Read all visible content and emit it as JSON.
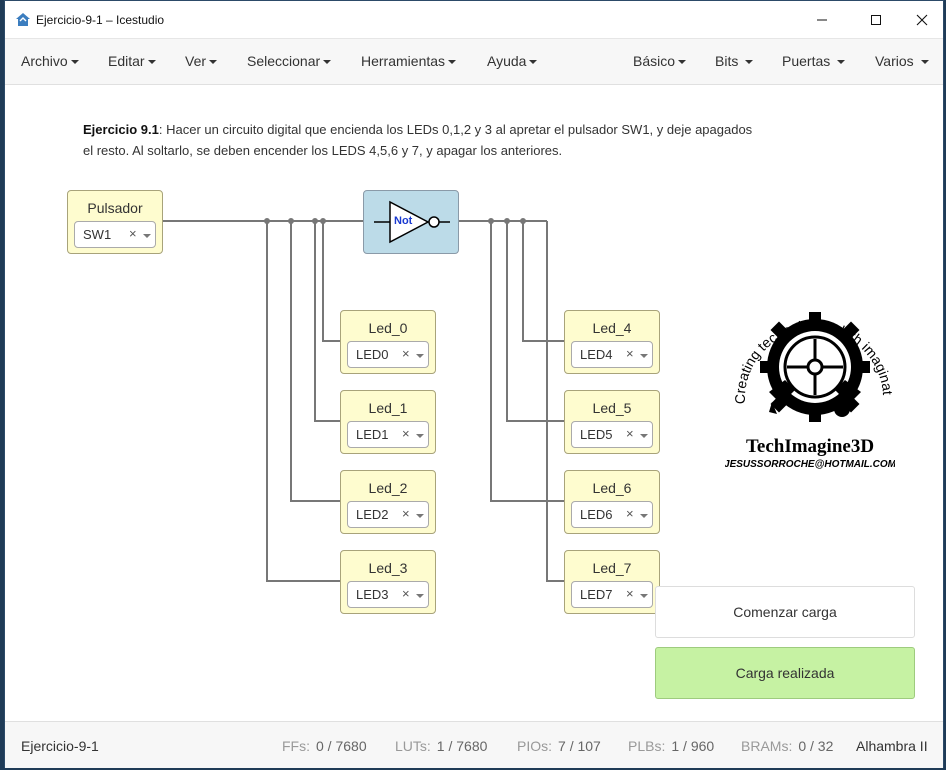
{
  "window": {
    "title": "Ejercicio-9-1 – Icestudio"
  },
  "menu": {
    "left": [
      "Archivo",
      "Editar",
      "Ver",
      "Seleccionar",
      "Herramientas",
      "Ayuda"
    ],
    "right": [
      "Básico",
      "Bits",
      "Puertas",
      "Varios"
    ]
  },
  "description": {
    "title": "Ejercicio 9.1",
    "text": ": Hacer un circuito digital que encienda los LEDs 0,1,2 y 3 al apretar el pulsador SW1, y deje apagados el resto. Al soltarlo, se deben encender los LEDS 4,5,6 y 7, y apagar los anteriores."
  },
  "input_block": {
    "label": "Pulsador",
    "value": "SW1"
  },
  "not_gate": {
    "label": "Not"
  },
  "leds_left": [
    {
      "label": "Led_0",
      "value": "LED0"
    },
    {
      "label": "Led_1",
      "value": "LED1"
    },
    {
      "label": "Led_2",
      "value": "LED2"
    },
    {
      "label": "Led_3",
      "value": "LED3"
    }
  ],
  "leds_right": [
    {
      "label": "Led_4",
      "value": "LED4"
    },
    {
      "label": "Led_5",
      "value": "LED5"
    },
    {
      "label": "Led_6",
      "value": "LED6"
    },
    {
      "label": "Led_7",
      "value": "LED7"
    }
  ],
  "select_clear": "×",
  "logo": {
    "arc_text": "Creating technology whith imagination",
    "brand": "TechImagine3D",
    "email": "JESUSSORROCHE@HOTMAIL.COM"
  },
  "buttons": {
    "start_upload": "Comenzar carga",
    "upload_done": "Carga realizada"
  },
  "footer": {
    "project": "Ejercicio-9-1",
    "stats": [
      {
        "label": "FFs:",
        "value": "0 / 7680"
      },
      {
        "label": "LUTs:",
        "value": "1 / 7680"
      },
      {
        "label": "PIOs:",
        "value": "7 / 107"
      },
      {
        "label": "PLBs:",
        "value": "1 / 960"
      },
      {
        "label": "BRAMs:",
        "value": "0 / 32"
      }
    ],
    "board": "Alhambra II"
  },
  "colors": {
    "block_bg": "#fefccf",
    "not_bg": "#bcdbe8",
    "done_bg": "#c6f2a3",
    "wire": "#777777"
  }
}
